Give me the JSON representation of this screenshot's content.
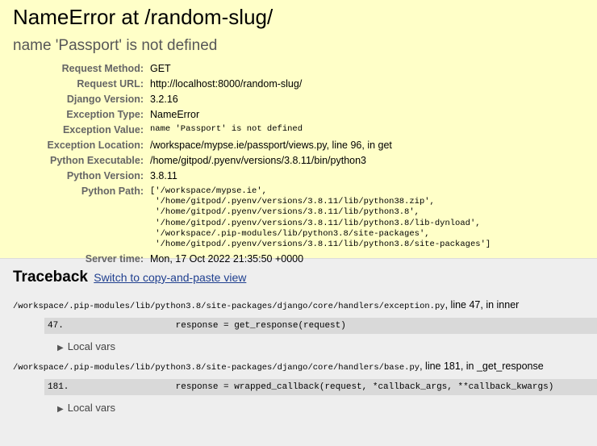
{
  "summary": {
    "title": "NameError at /random-slug/",
    "exception_value_heading": "name 'Passport' is not defined",
    "meta": [
      {
        "label": "Request Method:",
        "value": "GET",
        "mono": false
      },
      {
        "label": "Request URL:",
        "value": "http://localhost:8000/random-slug/",
        "mono": false
      },
      {
        "label": "Django Version:",
        "value": "3.2.16",
        "mono": false
      },
      {
        "label": "Exception Type:",
        "value": "NameError",
        "mono": false
      },
      {
        "label": "Exception Value:",
        "value": "name 'Passport' is not defined",
        "mono": true
      },
      {
        "label": "Exception Location:",
        "value": "/workspace/mypse.ie/passport/views.py, line 96, in get",
        "mono": false
      },
      {
        "label": "Python Executable:",
        "value": "/home/gitpod/.pyenv/versions/3.8.11/bin/python3",
        "mono": false
      },
      {
        "label": "Python Version:",
        "value": "3.8.11",
        "mono": false
      }
    ],
    "python_path_label": "Python Path:",
    "python_path": [
      "['/workspace/mypse.ie',",
      " '/home/gitpod/.pyenv/versions/3.8.11/lib/python38.zip',",
      " '/home/gitpod/.pyenv/versions/3.8.11/lib/python3.8',",
      " '/home/gitpod/.pyenv/versions/3.8.11/lib/python3.8/lib-dynload',",
      " '/workspace/.pip-modules/lib/python3.8/site-packages',",
      " '/home/gitpod/.pyenv/versions/3.8.11/lib/python3.8/site-packages']"
    ],
    "server_time_label": "Server time:",
    "server_time": "Mon, 17 Oct 2022 21:35:50 +0000"
  },
  "traceback": {
    "title": "Traceback",
    "switch_link": "Switch to copy-and-paste view",
    "frames": [
      {
        "path": "/workspace/.pip-modules/lib/python3.8/site-packages/django/core/handlers/exception.py",
        "suffix": ", line 47, in inner",
        "lineno": "47.",
        "code": "                response = get_response(request)",
        "local_vars": "Local vars"
      },
      {
        "path": "/workspace/.pip-modules/lib/python3.8/site-packages/django/core/handlers/base.py",
        "suffix": ", line 181, in _get_response",
        "lineno": "181.",
        "code": "                response = wrapped_callback(request, *callback_args, **callback_kwargs)",
        "local_vars": "Local vars"
      }
    ]
  }
}
